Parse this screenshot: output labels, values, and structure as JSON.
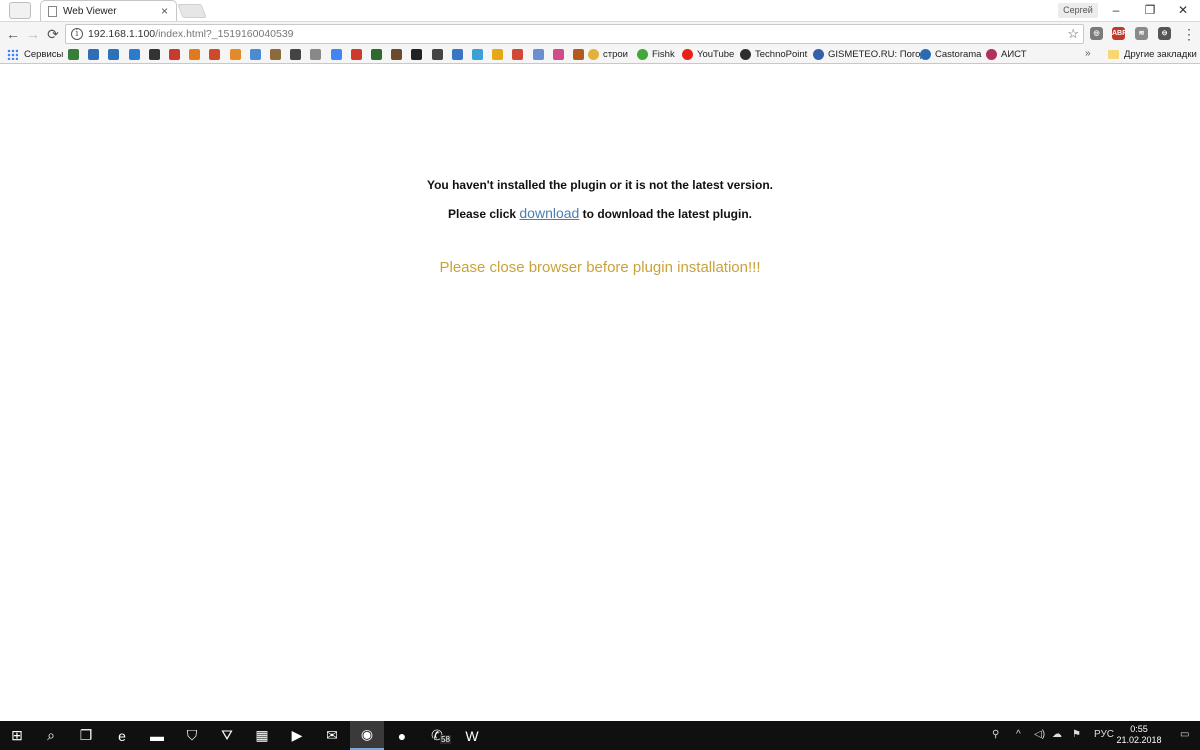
{
  "tab": {
    "title": "Web Viewer",
    "close": "×"
  },
  "profile": {
    "name": "Сергей"
  },
  "window_controls": {
    "minimize": "–",
    "restore": "❐",
    "close": "✕"
  },
  "toolbar": {
    "back": "←",
    "forward": "→",
    "reload": "⟳",
    "url_host": "192.168.1.100",
    "url_path": "/index.html?_1519160040539",
    "star": "☆",
    "extensions": [
      {
        "name": "adblock-shield-icon",
        "color": "#7a7a7a",
        "label": "◎"
      },
      {
        "name": "abp-icon",
        "color": "#c0392b",
        "label": "ABP"
      },
      {
        "name": "extension-icon",
        "color": "#8a8a8a",
        "label": "≋"
      },
      {
        "name": "vpn-icon",
        "color": "#555555",
        "label": "⊖"
      }
    ],
    "menu": "⋮"
  },
  "bookmarks": {
    "apps_label": "Сервисы",
    "items": [
      {
        "label": "строи",
        "color": "#e2b33b"
      },
      {
        "label": "Fishk",
        "color": "#42a83a"
      },
      {
        "label": "YouTube",
        "color": "#e62117"
      },
      {
        "label": "TechnoPoint",
        "color": "#2e2e2e"
      },
      {
        "label": "GISMETEO.RU: Погод",
        "color": "#3561a9"
      },
      {
        "label": "Castorama",
        "color": "#2b6cb0"
      },
      {
        "label": "АИСТ",
        "color": "#b0305e"
      }
    ],
    "icon_colors": [
      "#3a7d3a",
      "#2f6db5",
      "#2b72b8",
      "#2d7bd0",
      "#333333",
      "#c73b2d",
      "#e07a1f",
      "#d04a2a",
      "#e58a2a",
      "#4b8bd1",
      "#8c6a3b",
      "#444444",
      "#888888",
      "#4285f4",
      "#d03a2a",
      "#2d6b2d",
      "#6a4a2a",
      "#222222",
      "#444444",
      "#3a76c4",
      "#3aa0d8",
      "#e6a817",
      "#d14836",
      "#6a8fd0",
      "#d34a8a",
      "#b55a1d"
    ],
    "more": "»",
    "other_label": "Другие закладки"
  },
  "page": {
    "line1": "You haven't installed the plugin or it is not the latest version.",
    "line2_before": "Please click ",
    "line2_link": "download",
    "line2_after": " to download the latest plugin.",
    "line3": "Please close browser before plugin installation!!!"
  },
  "taskbar": {
    "apps": [
      {
        "name": "start-button",
        "glyph": "⊞",
        "active": false
      },
      {
        "name": "search-button",
        "glyph": "⌕",
        "active": false
      },
      {
        "name": "task-view-button",
        "glyph": "❐",
        "active": false
      },
      {
        "name": "edge-icon",
        "glyph": "e",
        "active": false
      },
      {
        "name": "file-explorer-icon",
        "glyph": "▬",
        "active": false
      },
      {
        "name": "store-icon",
        "glyph": "⛉",
        "active": false
      },
      {
        "name": "app-icon",
        "glyph": "⛛",
        "active": false
      },
      {
        "name": "calculator-icon",
        "glyph": "▦",
        "active": false
      },
      {
        "name": "media-player-icon",
        "glyph": "▶",
        "active": false
      },
      {
        "name": "mail-icon",
        "glyph": "✉",
        "active": false
      },
      {
        "name": "chrome-icon",
        "glyph": "◉",
        "active": true
      },
      {
        "name": "firefox-icon",
        "glyph": "●",
        "active": false
      },
      {
        "name": "viber-icon",
        "glyph": "✆",
        "active": false
      },
      {
        "name": "word-icon",
        "glyph": "W",
        "active": false
      }
    ],
    "viber_badge": "58",
    "tray_lang": "РУС",
    "time": "0:55",
    "date": "21.02.2018"
  }
}
